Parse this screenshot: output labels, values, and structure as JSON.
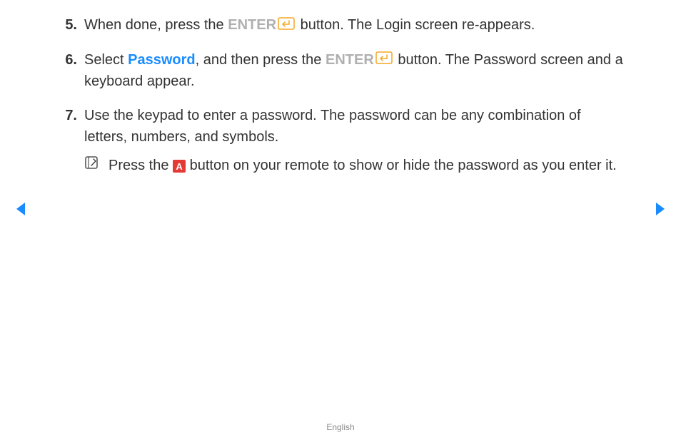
{
  "steps": {
    "5": {
      "number": "5.",
      "prefix": "When done, press the ",
      "enter": "ENTER",
      "suffix": " button. The Login screen re-appears."
    },
    "6": {
      "number": "6.",
      "prefix": "Select ",
      "password": "Password",
      "mid1": ", and then press the ",
      "enter": "ENTER",
      "mid2": " button. The Password screen and a keyboard appear."
    },
    "7": {
      "number": "7.",
      "text": "Use the keypad to enter a password. The password can be any combination of letters, numbers, and symbols."
    }
  },
  "note": {
    "prefix": "Press the ",
    "aLabel": "A",
    "suffix": " button on your remote to show or hide the password as you enter it."
  },
  "footer": "English"
}
